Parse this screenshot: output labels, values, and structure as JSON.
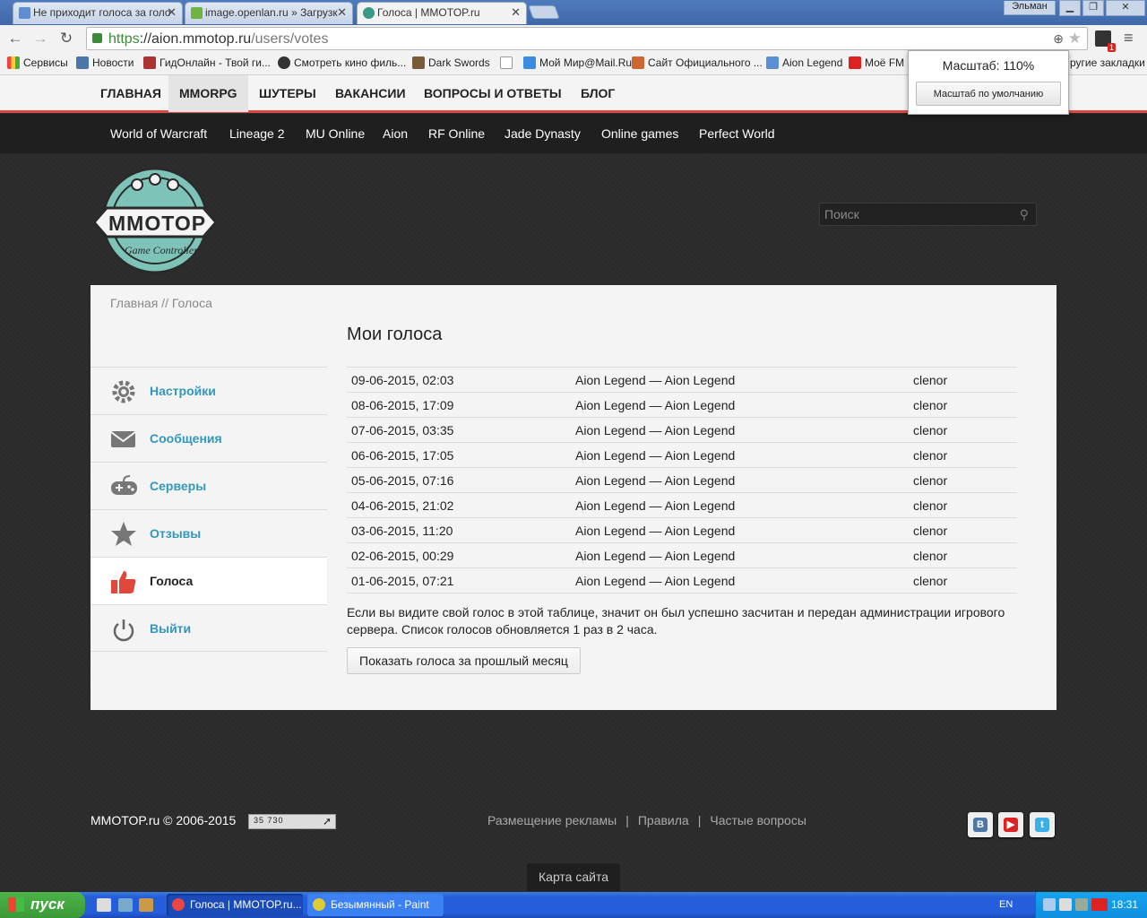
{
  "browser": {
    "tabs": [
      {
        "title": "Не приходит голоса за голо",
        "active": false
      },
      {
        "title": "image.openlan.ru » Загрузк",
        "active": false
      },
      {
        "title": "Голоса | MMOTOP.ru",
        "active": true
      }
    ],
    "user": "Эльман",
    "url_scheme": "https",
    "url_host": "://aion.mmotop.ru",
    "url_path": "/users/votes",
    "bookmarks": [
      "Сервисы",
      "Новости",
      "ГидОнлайн - Твой ги...",
      "Смотреть кино филь...",
      "Dark Swords",
      "",
      "Мой Мир@Mail.Ru",
      "Сайт Официального ...",
      "Aion Legend",
      "Моё  FM R",
      "ругие закладки"
    ],
    "zoom": {
      "label": "Масштаб: 110%",
      "reset_label": "Масштаб по умолчанию"
    }
  },
  "topnav": {
    "items": [
      "ГЛАВНАЯ",
      "MMORPG",
      "ШУТЕРЫ",
      "ВАКАНСИИ",
      "ВОПРОСЫ И ОТВЕТЫ",
      "БЛОГ"
    ],
    "active": "MMORPG"
  },
  "subnav": {
    "items": [
      "World of Warcraft",
      "Lineage 2",
      "MU Online",
      "Aion",
      "RF Online",
      "Jade Dynasty",
      "Online games",
      "Perfect World"
    ]
  },
  "logo": {
    "text": "MMOTOP",
    "tagline": "Game Controller"
  },
  "search": {
    "placeholder": "Поиск"
  },
  "breadcrumb": "Главная // Голоса",
  "sidebar": {
    "items": [
      {
        "label": "Настройки",
        "icon": "gear-icon"
      },
      {
        "label": "Сообщения",
        "icon": "envelope-icon"
      },
      {
        "label": "Серверы",
        "icon": "gamepad-icon"
      },
      {
        "label": "Отзывы",
        "icon": "star-icon"
      },
      {
        "label": "Голоса",
        "icon": "thumbs-up-icon",
        "active": true
      },
      {
        "label": "Выйти",
        "icon": "power-icon"
      }
    ]
  },
  "main": {
    "title": "Мои голоса",
    "votes": [
      {
        "date": "09-06-2015, 02:03",
        "server": "Aion Legend — Aion Legend",
        "user": "clenor"
      },
      {
        "date": "08-06-2015, 17:09",
        "server": "Aion Legend — Aion Legend",
        "user": "clenor"
      },
      {
        "date": "07-06-2015, 03:35",
        "server": "Aion Legend — Aion Legend",
        "user": "clenor"
      },
      {
        "date": "06-06-2015, 17:05",
        "server": "Aion Legend — Aion Legend",
        "user": "clenor"
      },
      {
        "date": "05-06-2015, 07:16",
        "server": "Aion Legend — Aion Legend",
        "user": "clenor"
      },
      {
        "date": "04-06-2015, 21:02",
        "server": "Aion Legend — Aion Legend",
        "user": "clenor"
      },
      {
        "date": "03-06-2015, 11:20",
        "server": "Aion Legend — Aion Legend",
        "user": "clenor"
      },
      {
        "date": "02-06-2015, 00:29",
        "server": "Aion Legend — Aion Legend",
        "user": "clenor"
      },
      {
        "date": "01-06-2015, 07:21",
        "server": "Aion Legend — Aion Legend",
        "user": "clenor"
      }
    ],
    "note": "Если вы видите свой голос в этой таблице, значит он был успешно засчитан и передан администрации игрового сервера. Список голосов обновляется 1 раз в 2 часа.",
    "prev_month_button": "Показать голоса за прошлый месяц"
  },
  "footer": {
    "copyright": "MMOTOP.ru © 2006-2015",
    "counter": "35 730",
    "links": [
      "Размещение рекламы",
      "Правила",
      "Частые вопросы"
    ],
    "sitemap": "Карта сайта",
    "social": [
      "vk-icon",
      "youtube-icon",
      "twitter-icon"
    ]
  },
  "taskbar": {
    "start": "пуск",
    "windows": [
      "Голоса | MMOTOP.ru...",
      "Безымянный - Paint"
    ],
    "lang": "EN",
    "clock": "18:31"
  },
  "colors": {
    "accent": "#e0483d",
    "link": "#3397bb",
    "topnav_bg": "#f4f4f4",
    "subnav_bg": "#1f1f1f"
  }
}
